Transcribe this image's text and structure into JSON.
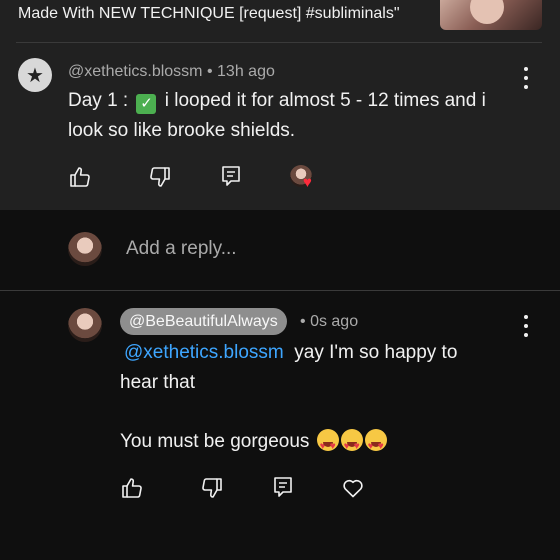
{
  "video": {
    "title": "Made With NEW TECHNIQUE [request] #subliminals\""
  },
  "comment": {
    "author": "@xethetics.blossm",
    "separator": "•",
    "time": "13h ago",
    "text_prefix": "Day 1 :",
    "text_line1_rest": "i looped it for almost 5 - 12 times and i",
    "text_line2": "look so like brooke shields.",
    "check_emoji": "✓",
    "heart_glyph": "♥",
    "colors": {
      "heart": "#ff2b3c",
      "check": "#4caf50"
    }
  },
  "reply_box": {
    "placeholder": "Add a reply..."
  },
  "reply": {
    "author": "@BeBeautifulAlways",
    "separator": "•",
    "time": "0s ago",
    "mention": "@xethetics.blossm",
    "text_line1": "yay I'm so happy to",
    "text_line2": "hear that",
    "text_line3": "You must be gorgeous",
    "colors": {
      "mention": "#3ea6ff",
      "chip": "#8e8e8e"
    }
  },
  "icons": [
    "thumbs-up-icon",
    "thumbs-down-icon",
    "reply-icon",
    "more-vertical-icon",
    "heart-icon"
  ]
}
